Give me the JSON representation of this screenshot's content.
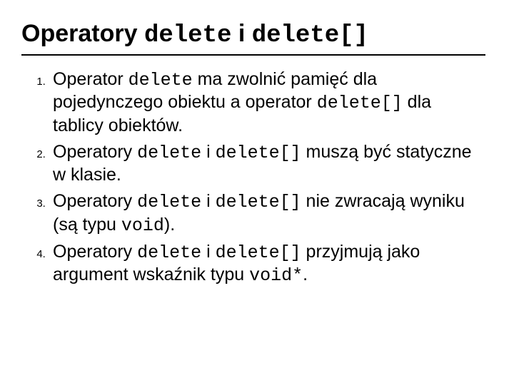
{
  "title": {
    "prefix": "Operatory ",
    "code1": "delete",
    "mid": " i ",
    "code2": "delete[]"
  },
  "items": [
    {
      "t0": "Operator ",
      "c0": "delete",
      "t1": " ma zwolnić pamięć dla pojedynczego obiektu a operator ",
      "c1": "delete[]",
      "t2": " dla tablicy obiektów."
    },
    {
      "t0": "Operatory ",
      "c0": "delete",
      "t1": " i ",
      "c1": "delete[]",
      "t2": " muszą być statyczne w klasie."
    },
    {
      "t0": "Operatory ",
      "c0": "delete",
      "t1": " i ",
      "c1": "delete[]",
      "t2": " nie zwracają wyniku (są typu ",
      "c2": "void",
      "t3": ")."
    },
    {
      "t0": "Operatory ",
      "c0": "delete",
      "t1": " i ",
      "c1": "delete[]",
      "t2": " przyjmują jako argument wskaźnik typu ",
      "c2": "void*",
      "t3": "."
    }
  ]
}
